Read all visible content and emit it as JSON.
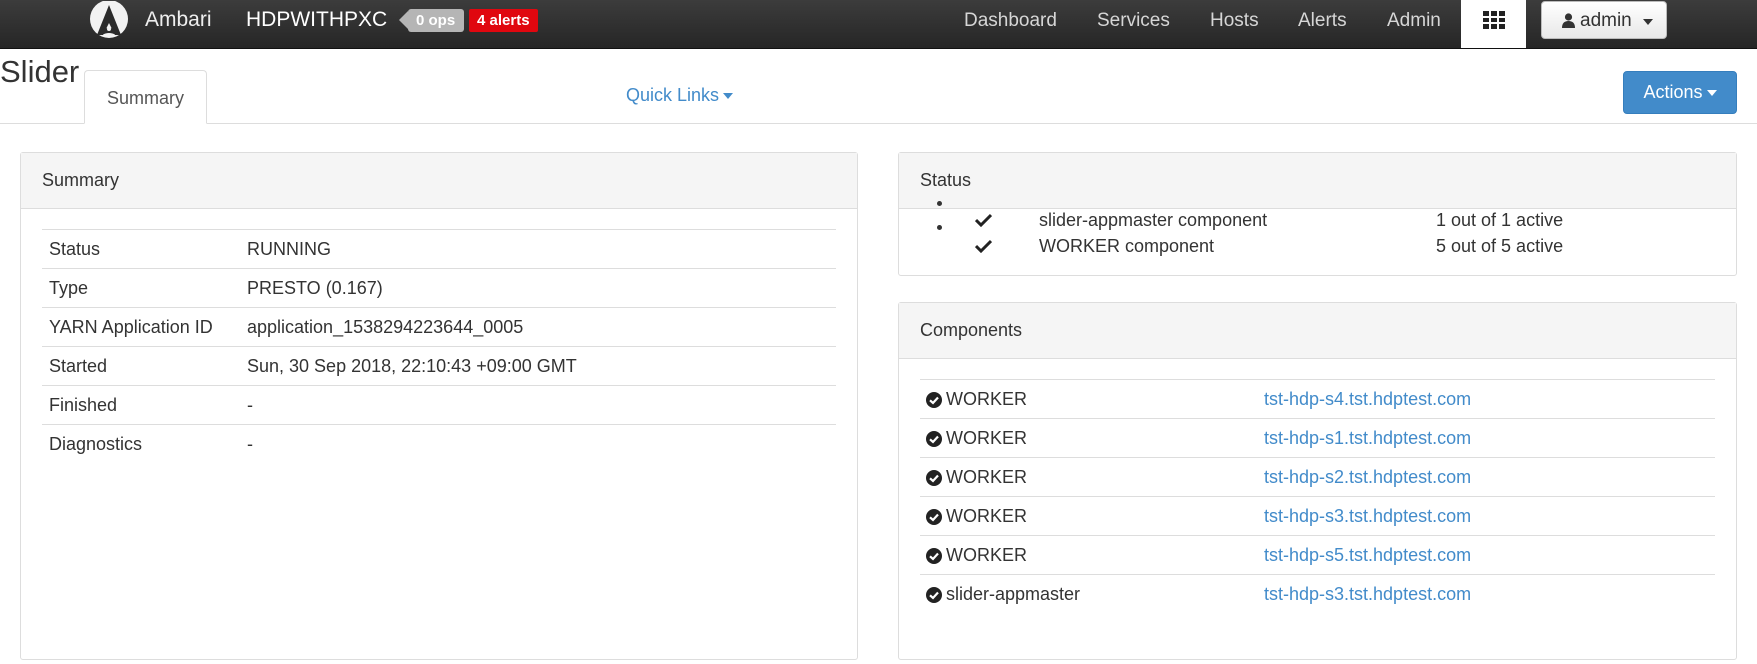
{
  "nav": {
    "brand": "Ambari",
    "cluster_name": "HDPWITHPXC",
    "ops_badge": "0 ops",
    "alerts_badge": "4 alerts",
    "items": [
      "Dashboard",
      "Services",
      "Hosts",
      "Alerts",
      "Admin"
    ],
    "user_label": "admin",
    "colors": {
      "bar": "#2f2f2f",
      "alert": "#e0070f",
      "ops": "#b5b5b5"
    }
  },
  "page": {
    "title": "Slider",
    "tab_active": "Summary",
    "quick_links": "Quick Links",
    "actions": "Actions"
  },
  "summary": {
    "heading": "Summary",
    "rows": [
      {
        "key": "Status",
        "value": "RUNNING"
      },
      {
        "key": "Type",
        "value": "PRESTO (0.167)"
      },
      {
        "key": "YARN Application ID",
        "value": "application_1538294223644_0005"
      },
      {
        "key": "Started",
        "value": "Sun, 30 Sep 2018, 22:10:43 +09:00 GMT"
      },
      {
        "key": "Finished",
        "value": "-"
      },
      {
        "key": "Diagnostics",
        "value": "-"
      }
    ]
  },
  "status": {
    "heading": "Status",
    "items": [
      {
        "name": "slider-appmaster component",
        "count": "1 out of 1 active"
      },
      {
        "name": "WORKER component",
        "count": "5 out of 5 active"
      }
    ]
  },
  "components": {
    "heading": "Components",
    "rows": [
      {
        "name": "WORKER",
        "host": "tst-hdp-s4.tst.hdptest.com"
      },
      {
        "name": "WORKER",
        "host": "tst-hdp-s1.tst.hdptest.com"
      },
      {
        "name": "WORKER",
        "host": "tst-hdp-s2.tst.hdptest.com"
      },
      {
        "name": "WORKER",
        "host": "tst-hdp-s3.tst.hdptest.com"
      },
      {
        "name": "WORKER",
        "host": "tst-hdp-s5.tst.hdptest.com"
      },
      {
        "name": "slider-appmaster",
        "host": "tst-hdp-s3.tst.hdptest.com"
      }
    ]
  },
  "icons": {
    "logo": "ambari-logo-icon",
    "apps": "grid-apps-icon",
    "user": "user-icon",
    "check": "check-icon",
    "circle_check": "circle-check-icon"
  },
  "colors": {
    "link": "#428bca",
    "primary": "#428bca"
  }
}
